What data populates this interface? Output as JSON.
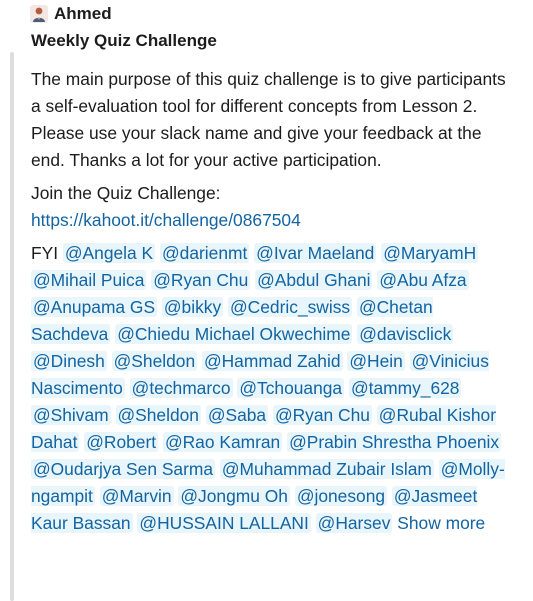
{
  "message": {
    "author": "Ahmed",
    "avatar_icon": "person-avatar-icon",
    "attachment": {
      "title": "Weekly Quiz Challenge",
      "description": "The main purpose of this quiz challenge is to give participants a self-evaluation tool for different concepts from Lesson 2. Please use your slack name and give your feedback at the end. Thanks a lot for your active participation.",
      "join_label": "Join the Quiz Challenge:",
      "join_link": "https://kahoot.it/challenge/0867504",
      "fyi_label": "FYI",
      "mentions": [
        "@Angela K",
        "@darienmt",
        "@Ivar Maeland",
        "@MaryamH",
        "@Mihail Puica",
        "@Ryan Chu",
        "@Abdul Ghani",
        "@Abu Afza",
        "@Anupama GS",
        "@bikky",
        "@Cedric_swiss",
        "@Chetan Sachdeva",
        "@Chiedu Michael Okwechime",
        "@davisclick",
        "@Dinesh",
        "@Sheldon",
        "@Hammad Zahid",
        "@Hein",
        "@Vinicius Nascimento",
        "@techmarco",
        "@Tchouanga",
        "@tammy_628",
        "@Shivam",
        "@Sheldon",
        "@Saba",
        "@Ryan Chu",
        "@Rubal Kishor Dahat",
        "@Robert",
        "@Rao Kamran",
        "@Prabin Shrestha Phoenix",
        "@Oudarjya Sen Sarma",
        "@Muhammad Zubair Islam",
        "@Molly-ngampit",
        "@Marvin",
        "@Jongmu Oh",
        "@jonesong",
        "@Jasmeet Kaur Bassan",
        "@HUSSAIN LALLANI",
        "@Harsev"
      ],
      "show_more": "Show more"
    }
  },
  "colors": {
    "link": "#1264a3",
    "mention_bg": "#e8f5fa",
    "text": "#1d1c1d",
    "quote_bar": "#dddddd"
  }
}
